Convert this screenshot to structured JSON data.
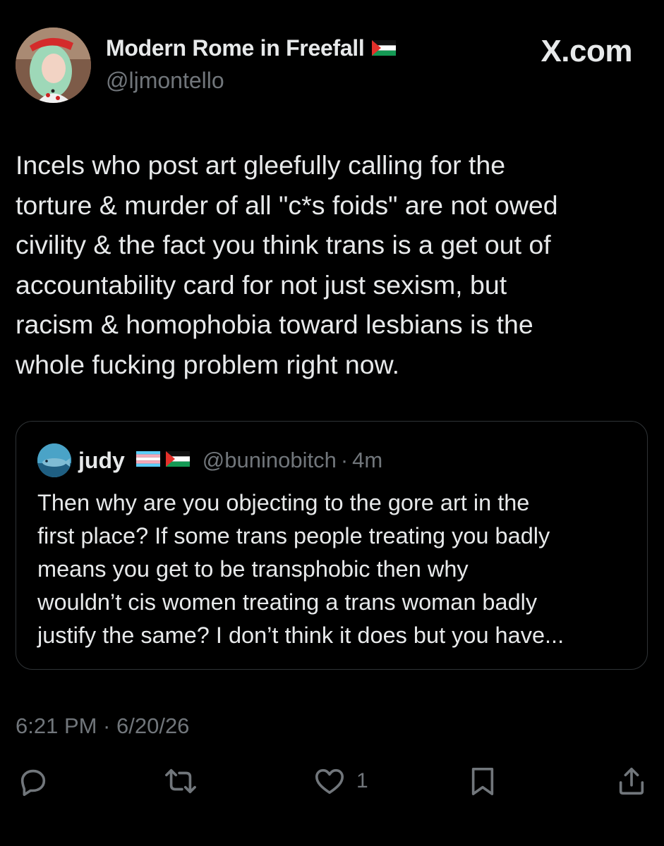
{
  "header": {
    "display_name": "Modern Rome in Freefall",
    "handle": "@ljmontello",
    "flag_icon": "palestine-flag-icon",
    "site_badge": "X.com"
  },
  "tweet": {
    "lines": [
      "Incels who post art gleefully calling for the",
      "torture & murder of all \"c*s foids\" are not owed",
      "civility & the fact you think trans is a get out of",
      "accountability card for not just sexism, but",
      "racism & homophobia toward lesbians is the",
      "whole fucking problem right now."
    ],
    "timestamp": "6:21 PM · 6/20/26"
  },
  "quote": {
    "name": "judy",
    "flags": [
      "trans-flag-icon",
      "palestine-flag-icon"
    ],
    "handle": "@buninobitch",
    "separator": "·",
    "time": "4m",
    "lines": [
      "Then why are you objecting to the gore art in the",
      "first place? If some trans people treating you badly",
      "means you get to be transphobic then why",
      "wouldn’t cis women treating a trans woman badly",
      "justify the same? I don’t think it does but you have..."
    ]
  },
  "actions": {
    "reply_icon": "reply-icon",
    "repost_icon": "repost-icon",
    "like_icon": "heart-icon",
    "like_count": "1",
    "bookmark_icon": "bookmark-icon",
    "share_icon": "share-icon"
  },
  "colors": {
    "background": "#000000",
    "text": "#e7e9ea",
    "secondary": "#71767b",
    "border": "#2f3336"
  }
}
